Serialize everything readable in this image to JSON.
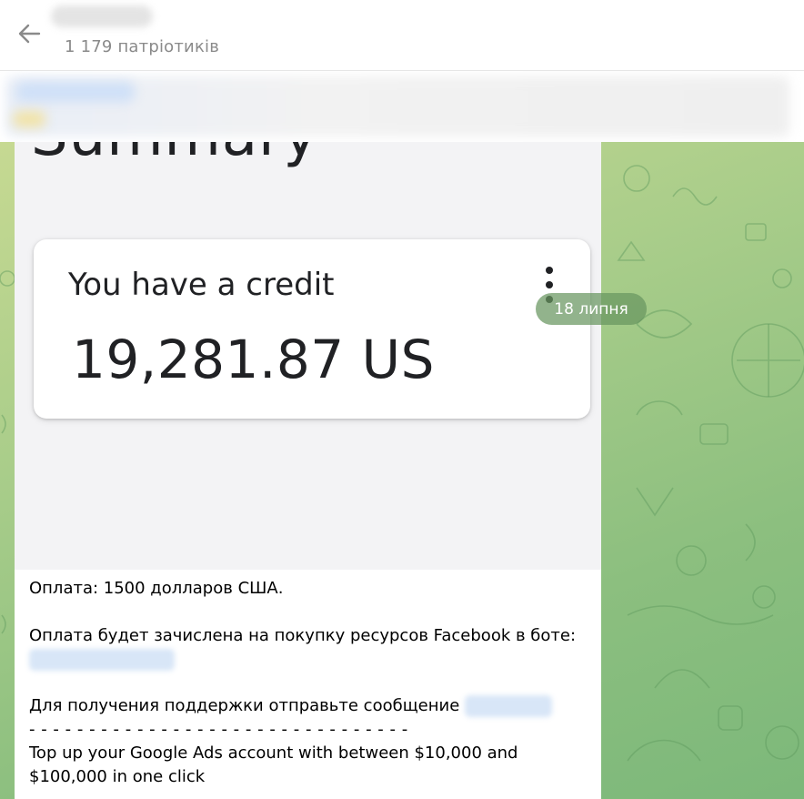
{
  "header": {
    "back_icon": "arrow-left-icon",
    "subscribers": "1 179 патріотиків"
  },
  "date_badge": "18 липня",
  "photo": {
    "heading": "Summary",
    "card_title": "You have a credit",
    "card_amount": "19,281.87 US",
    "menu_icon": "more-vertical-icon"
  },
  "caption": {
    "payment": "Оплата: 1500 долларов США.",
    "credit_note": "Оплата будет зачислена на покупку ресурсов Facebook в боте:",
    "support": "Для получения поддержки отправьте сообщение",
    "divider": "- - - - - - - - - - - - - - - - - - - - - - - - - - - - - - - -",
    "topup": "Top up your Google Ads account with between $10,000 and $100,000 in one click"
  },
  "colors": {
    "chat_bg_start": "#c6d992",
    "chat_bg_end": "#7cb87a",
    "badge_bg": "#6a9660"
  }
}
